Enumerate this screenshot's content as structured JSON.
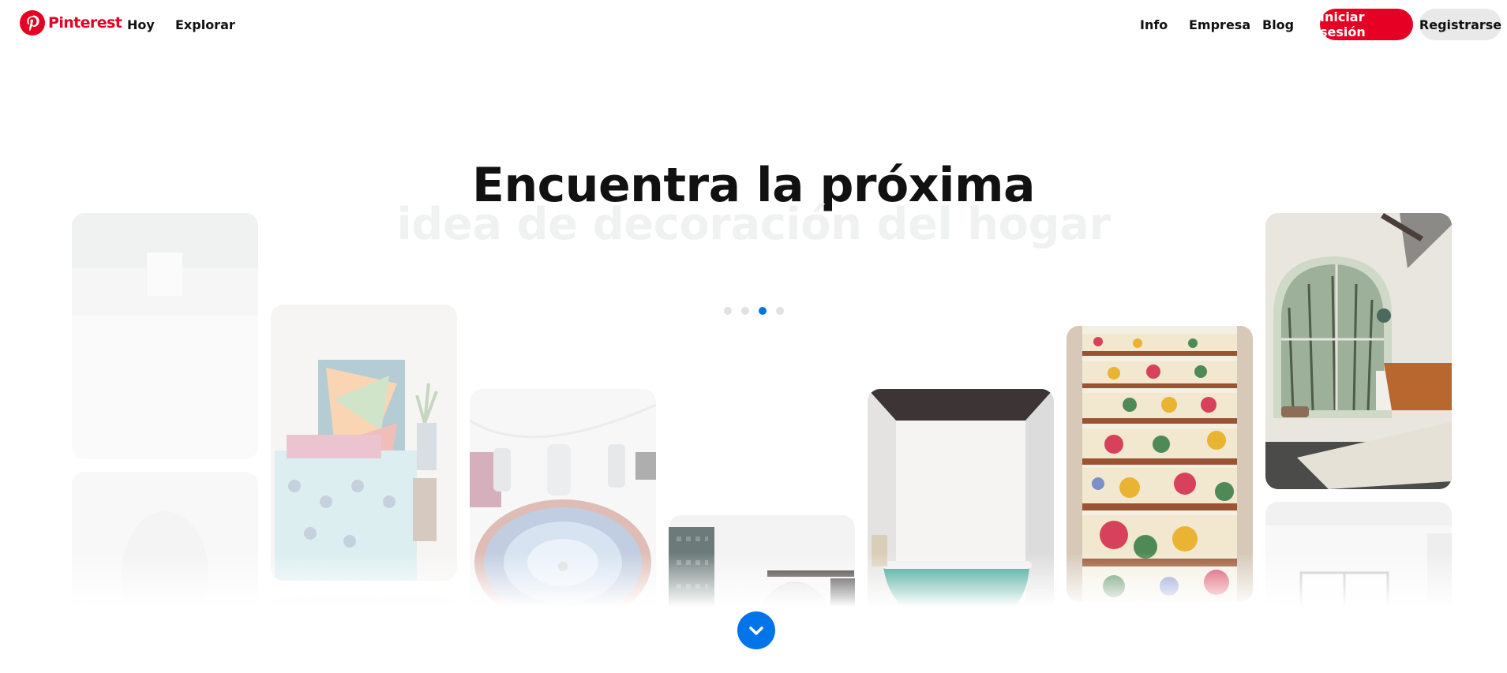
{
  "header": {
    "logo_text": "Pinterest",
    "nav_left": [
      "Hoy",
      "Explorar"
    ],
    "nav_right": [
      "Info",
      "Empresa",
      "Blog"
    ],
    "login_label": "Iniciar sesión",
    "signup_label": "Registrarse"
  },
  "hero": {
    "headline": "Encuentra la próxima",
    "subline": "idea de decoración del hogar",
    "carousel": {
      "dot_count": 4,
      "active_index": 2
    }
  },
  "colors": {
    "brand": "#e60023",
    "accent": "#0074e8"
  },
  "icons": {
    "logo": "pinterest-logo-icon",
    "scroll": "chevron-down-icon"
  },
  "pins": [
    "white tiled wall",
    "wallpaper wall",
    "bedroom with colorful art",
    "marble sink with mosaic bowl",
    "bathroom with wallpaper and arch",
    "bathroom with teal clawfoot tub",
    "floral painted stairs",
    "bedroom with arched window",
    "hallway with windows"
  ]
}
